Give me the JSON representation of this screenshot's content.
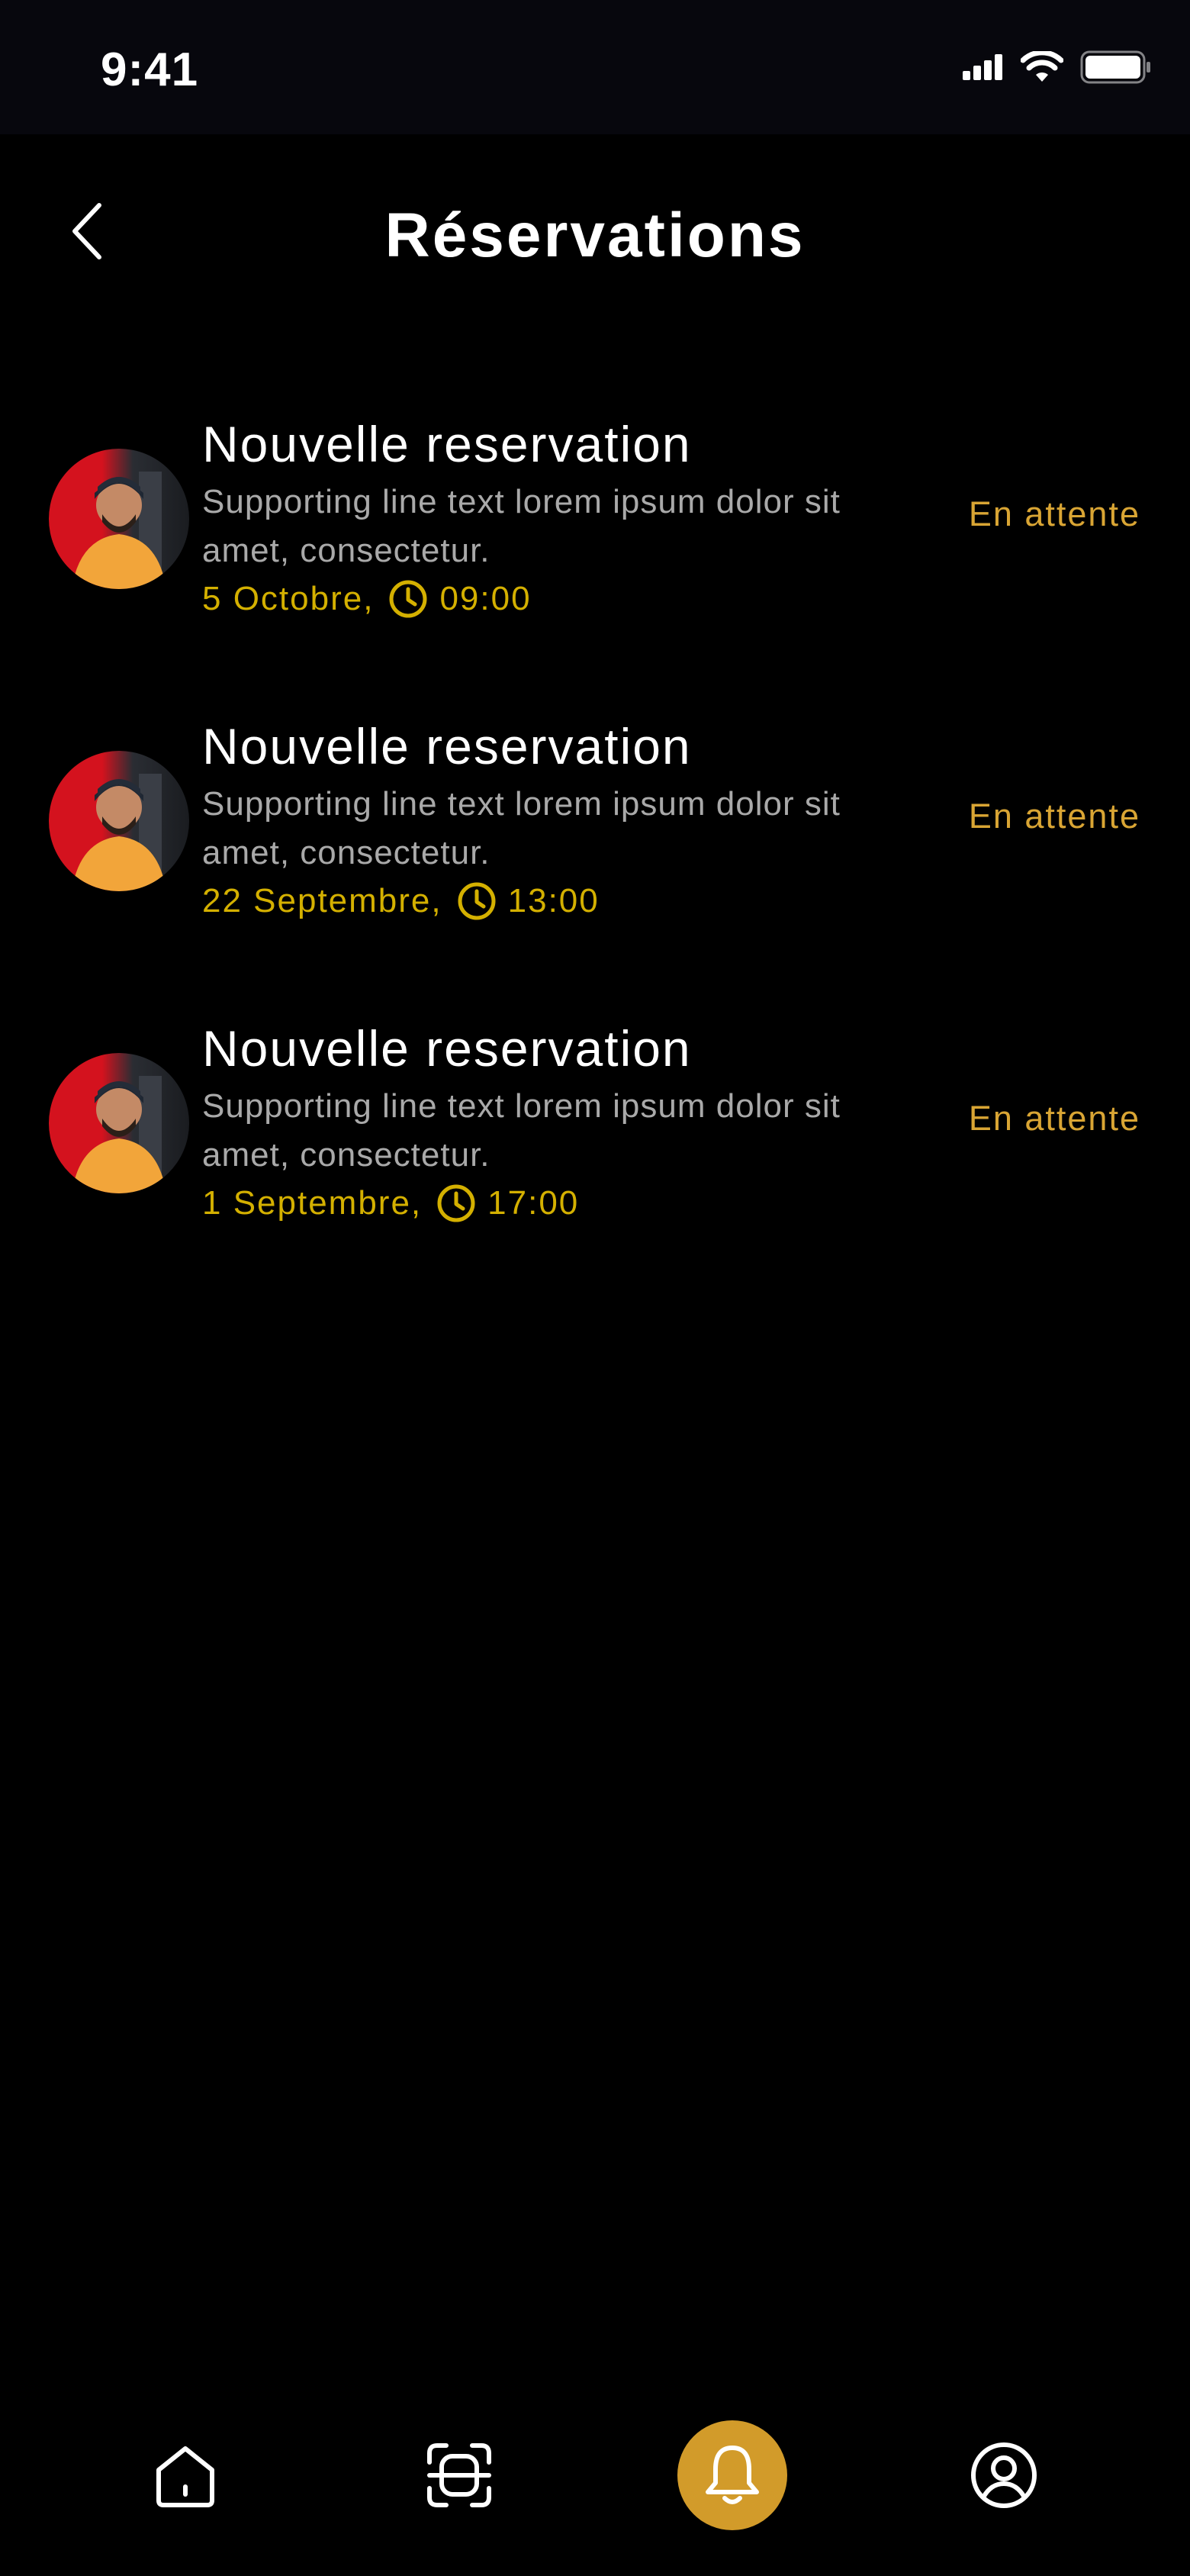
{
  "status_bar": {
    "time": "9:41"
  },
  "header": {
    "title": "Réservations"
  },
  "reservations": [
    {
      "title": "Nouvelle reservation",
      "description": "Supporting line text lorem ipsum dolor sit amet, consectetur.",
      "date": "5 Octobre,",
      "time": "09:00",
      "status": "En attente"
    },
    {
      "title": "Nouvelle reservation",
      "description": "Supporting line text lorem ipsum dolor sit amet, consectetur.",
      "date": "22 Septembre,",
      "time": "13:00",
      "status": "En attente"
    },
    {
      "title": "Nouvelle reservation",
      "description": "Supporting line text lorem ipsum dolor sit amet, consectetur.",
      "date": "1 Septembre,",
      "time": "17:00",
      "status": "En attente"
    }
  ],
  "nav": {
    "items": [
      "home-icon",
      "scan-icon",
      "bell-icon",
      "profile-icon"
    ],
    "active": "bell-icon"
  },
  "colors": {
    "background": "#000000",
    "accent": "#d29b2a",
    "date_text": "#d4b000",
    "status_text": "#d9a534",
    "secondary_text": "#a9a9a9"
  }
}
